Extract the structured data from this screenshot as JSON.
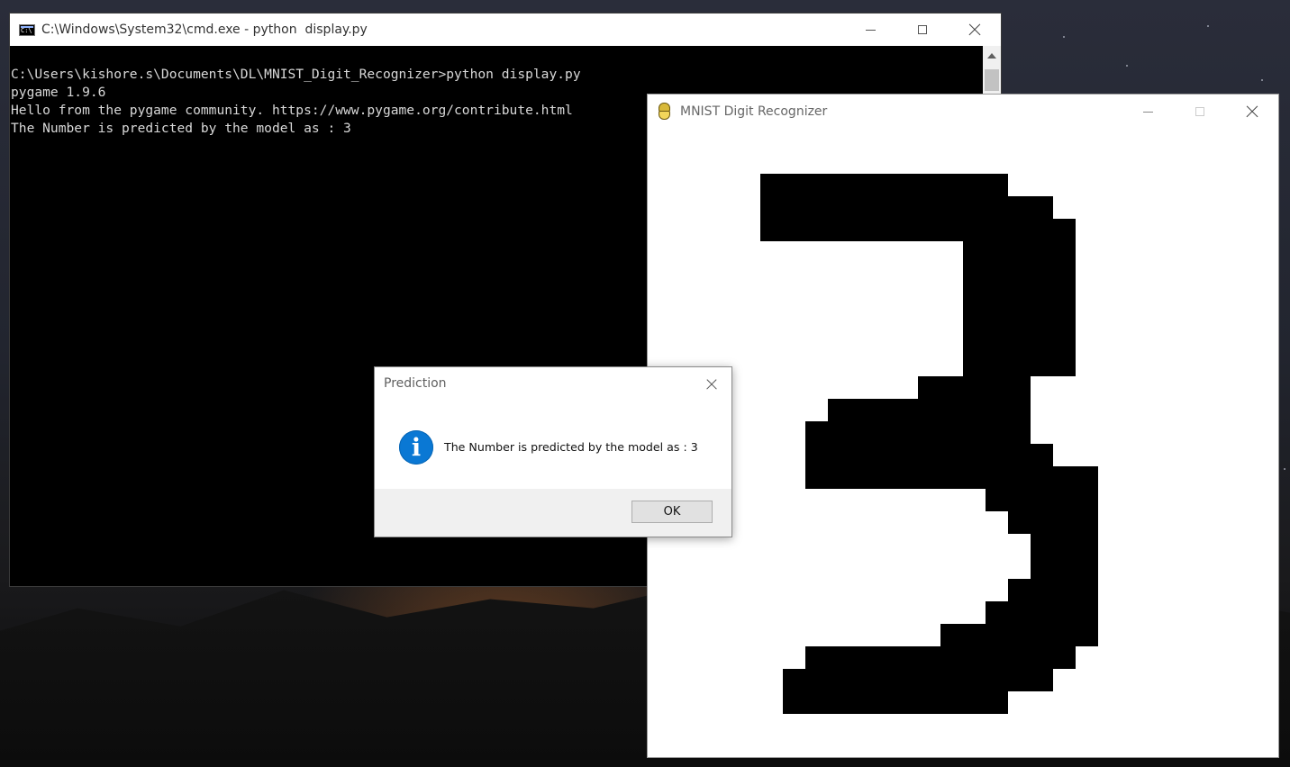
{
  "desktop": {
    "accent_sky": "#2a2d3a",
    "accent_glow": "#78dc28"
  },
  "cmd_window": {
    "title": "C:\\Windows\\System32\\cmd.exe - python  display.py",
    "lines": [
      "C:\\Users\\kishore.s\\Documents\\DL\\MNIST_Digit_Recognizer>python display.py",
      "pygame 1.9.6",
      "Hello from the pygame community. https://www.pygame.org/contribute.html",
      "The Number is predicted by the model as : 3"
    ],
    "controls": [
      "minimize-icon",
      "maximize-icon",
      "close-icon"
    ]
  },
  "pygame_window": {
    "title": "MNIST Digit Recognizer",
    "controls": [
      "minimize-icon",
      "maximize-icon",
      "close-icon"
    ],
    "digit_color": "#000000",
    "canvas_color": "#ffffff"
  },
  "dialog": {
    "title": "Prediction",
    "icon": "info-icon",
    "icon_glyph": "i",
    "icon_color": "#0a78d4",
    "message": "The Number is predicted by the model as : 3",
    "ok_label": "OK"
  }
}
